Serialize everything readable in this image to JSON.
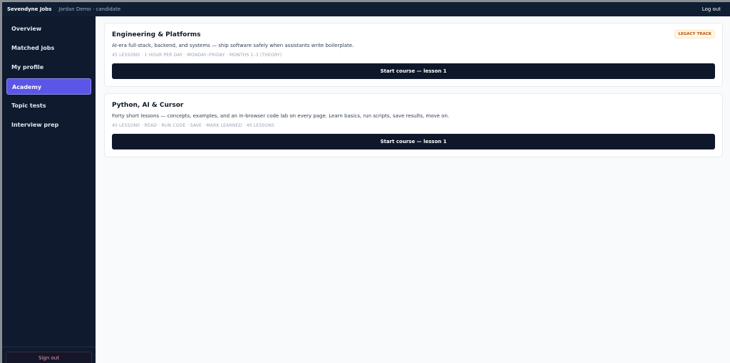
{
  "topbar": {
    "brand": "Sevendyne Jobs",
    "user": "Jordan Demo · candidate",
    "logout_label": "Log out"
  },
  "sidebar": {
    "items": [
      {
        "label": "Overview"
      },
      {
        "label": "Matched jobs"
      },
      {
        "label": "My profile"
      },
      {
        "label": "Academy",
        "active": true
      },
      {
        "label": "Topic tests"
      },
      {
        "label": "Interview prep"
      }
    ],
    "signout_label": "Sign out"
  },
  "courses": [
    {
      "title": "Engineering & Platforms",
      "badge": "LEGACY TRACK",
      "description": "AI-era full-stack, backend, and systems — ship software safely when assistants write boilerplate.",
      "meta": "45 LESSONS · 1 HOUR PER DAY · MONDAY–FRIDAY · MONTHS 1–3 (THEORY)",
      "button_label": "Start course — lesson 1"
    },
    {
      "title": "Python, AI & Cursor",
      "description": "Forty short lessons — concepts, examples, and an in-browser code lab on every page. Learn basics, run scripts, save results, move on.",
      "meta": "40 LESSONS · READ · RUN CODE · SAVE · MARK LEARNED · 40 LESSONS",
      "button_label": "Start course — lesson 1"
    }
  ],
  "colors": {
    "topbar_bg": "#0f1e33",
    "sidebar_bg": "#101a2e",
    "accent": "#5b55e8",
    "button_bg": "#0f172a",
    "badge_text": "#b45309"
  }
}
